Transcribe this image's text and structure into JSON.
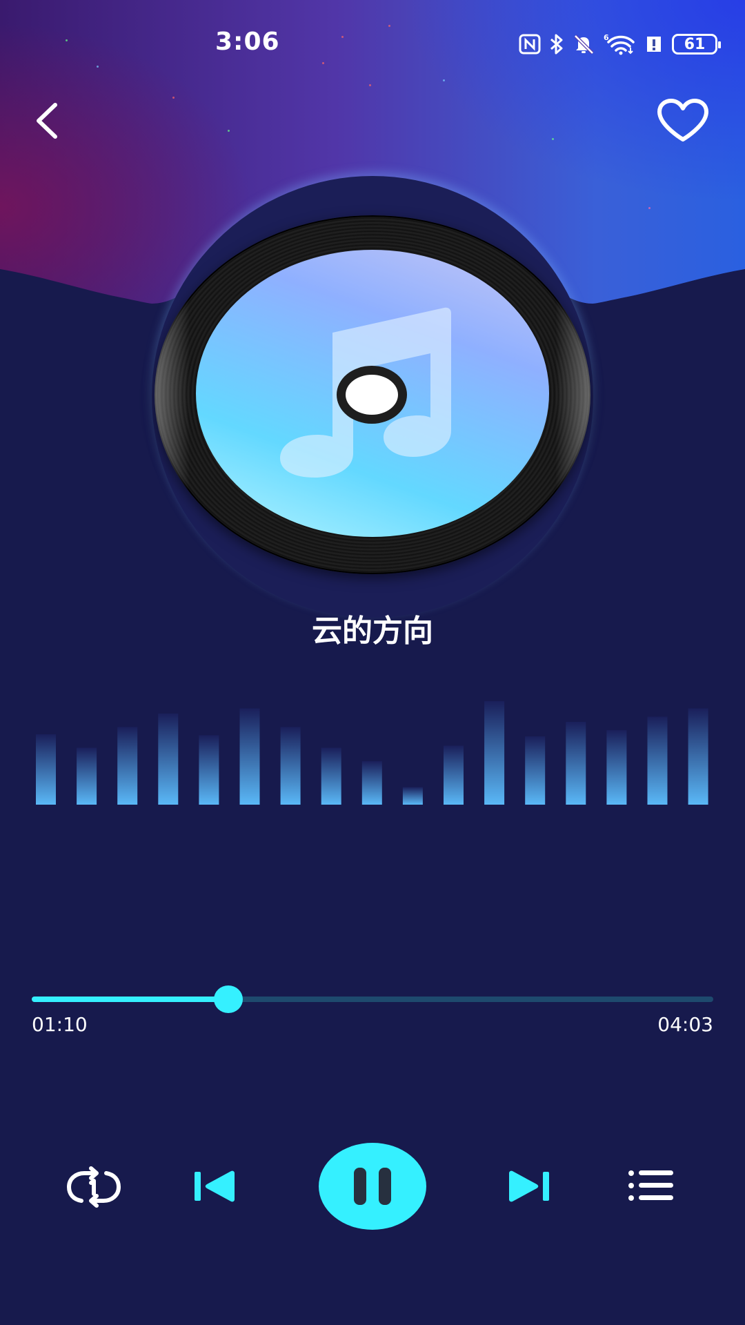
{
  "status_bar": {
    "time": "3:06",
    "battery_level": "61",
    "icons": [
      "nfc-icon",
      "bluetooth-icon",
      "mute-bell-icon",
      "wifi-6-icon",
      "alert-icon",
      "battery-icon"
    ]
  },
  "header": {
    "back_icon": "chevron-left-icon",
    "favorite_icon": "heart-outline-icon"
  },
  "now_playing": {
    "title": "云的方向",
    "artwork_icon": "music-note-icon"
  },
  "visualizer": {
    "levels": [
      0.68,
      0.55,
      0.75,
      0.88,
      0.67,
      0.93,
      0.75,
      0.55,
      0.42,
      0.17,
      0.57,
      1.0,
      0.66,
      0.8,
      0.72,
      0.85,
      0.93
    ],
    "color_top": "#1a1f5a",
    "color_bottom": "#5ab8f7"
  },
  "progress": {
    "current": "01:10",
    "total": "04:03",
    "fraction": 0.288,
    "fill_color": "#35f0ff",
    "track_color": "#1e4a6e"
  },
  "controls": {
    "repeat_icon": "repeat-one-icon",
    "previous_icon": "skip-previous-icon",
    "play_pause_icon": "pause-icon",
    "next_icon": "skip-next-icon",
    "playlist_icon": "playlist-icon",
    "accent": "#35f0ff"
  },
  "colors": {
    "background": "#171a4d",
    "accent": "#35f0ff"
  }
}
